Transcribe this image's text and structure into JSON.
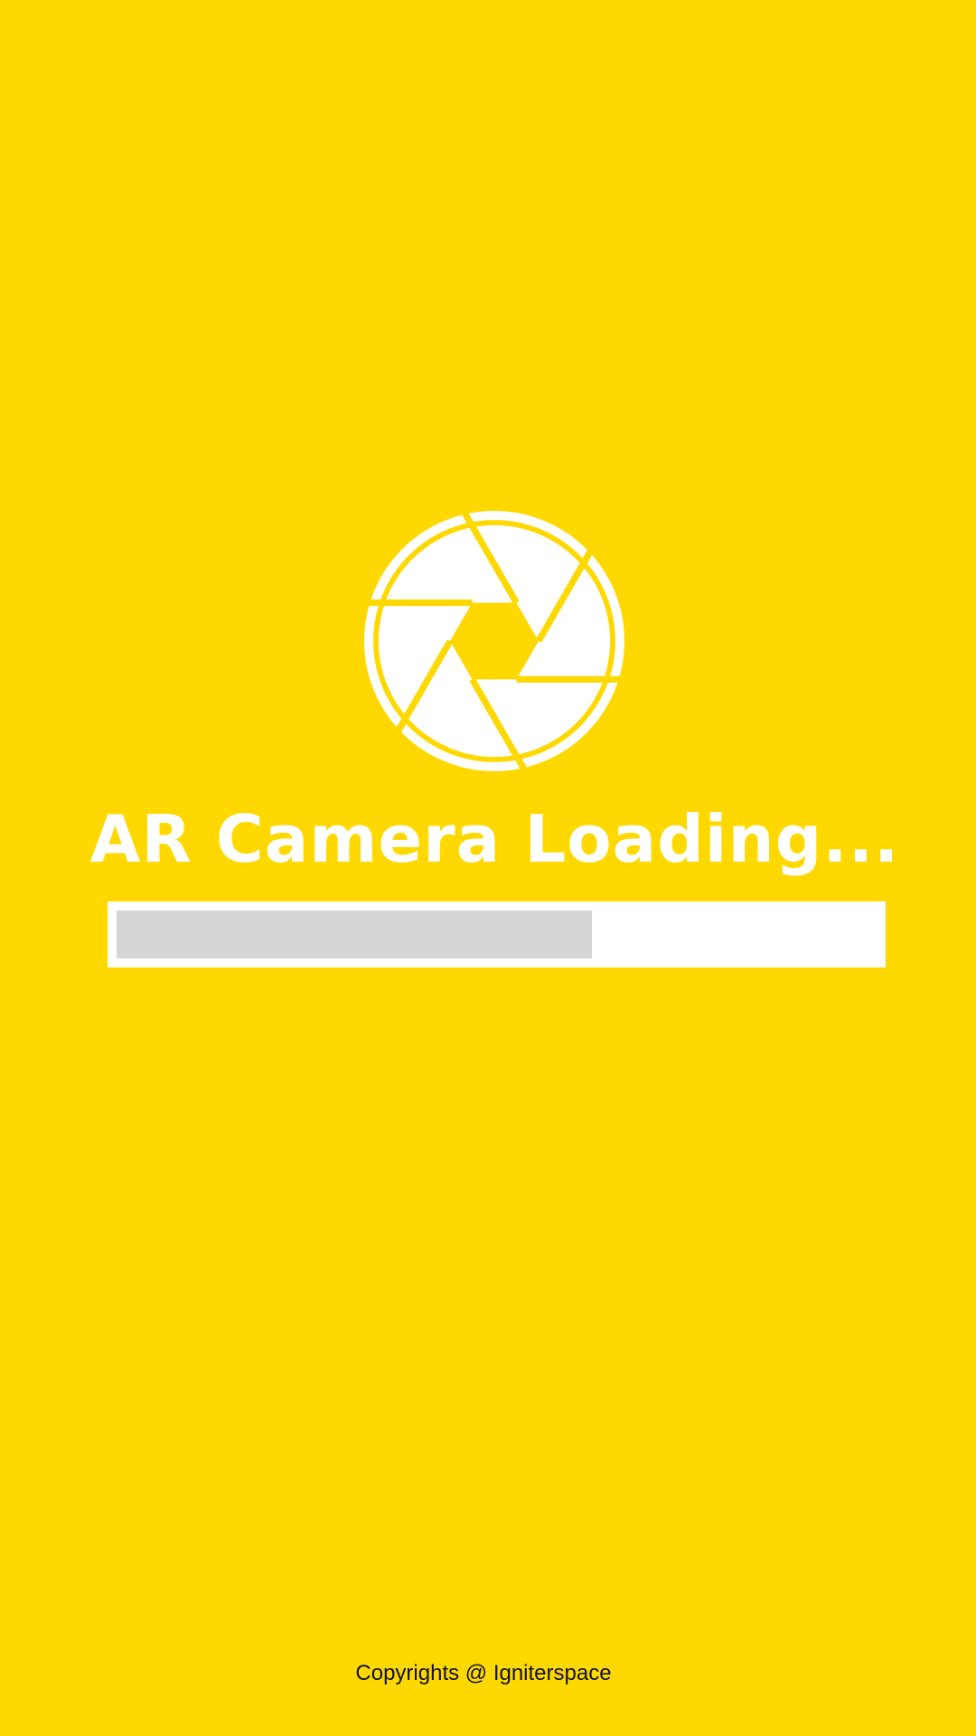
{
  "app": {
    "title": "AR Camera Loading...",
    "footer": "Copyrights @ Igniterspace",
    "logo_icon": "camera-aperture-icon"
  },
  "progress": {
    "fraction": 0.625
  },
  "colors": {
    "background": "#FFD800",
    "foreground": "#FFFFFF",
    "progress_track": "#FFFFFF",
    "progress_fill": "#D6D6D6",
    "footer_text": "#111111"
  }
}
